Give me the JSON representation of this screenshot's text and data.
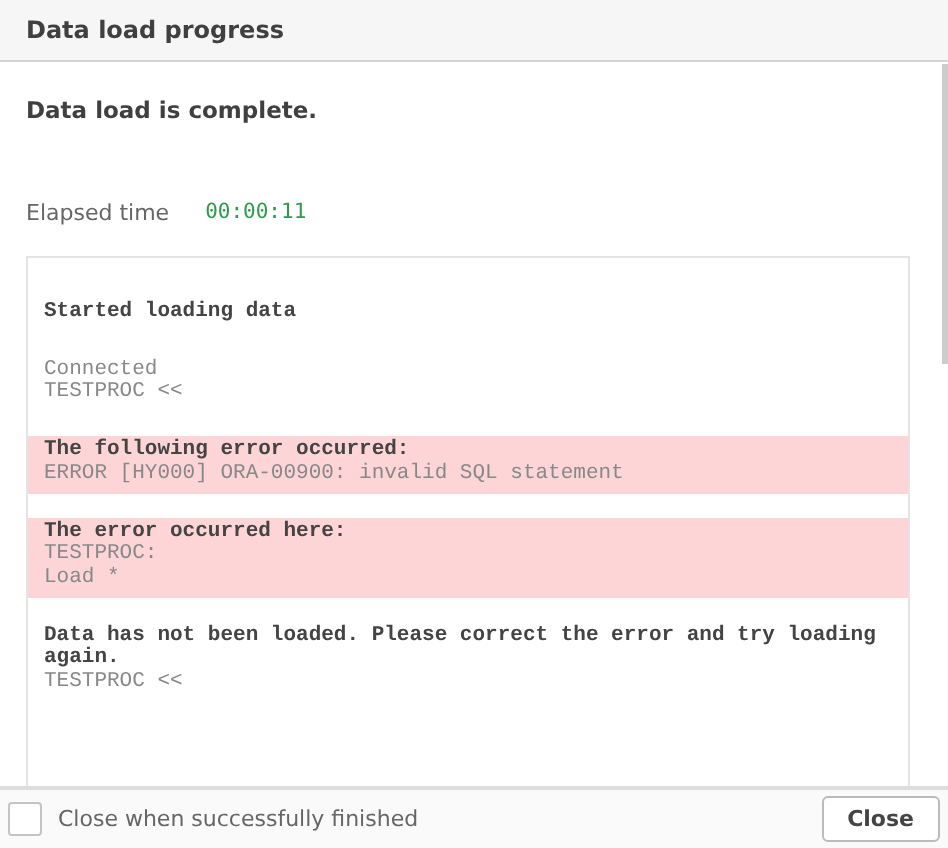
{
  "window": {
    "title": "Data load progress"
  },
  "status": "Data load is complete.",
  "elapsed": {
    "label": "Elapsed time",
    "value": "00:00:11"
  },
  "log": [
    {
      "kind": "info",
      "lines": [
        {
          "text": "Started loading data",
          "bold": true
        }
      ]
    },
    {
      "kind": "info",
      "lines": [
        {
          "text": "Connected",
          "bold": false
        },
        {
          "text": "TESTPROC <<",
          "bold": false
        }
      ]
    },
    {
      "kind": "error",
      "lines": [
        {
          "text": "The following error occurred:",
          "bold": true
        },
        {
          "text": "ERROR [HY000] ORA-00900: invalid SQL statement",
          "bold": false
        }
      ]
    },
    {
      "kind": "error",
      "lines": [
        {
          "text": "The error occurred here:",
          "bold": true
        },
        {
          "text": "TESTPROC:",
          "bold": false
        },
        {
          "text": "Load *",
          "bold": false
        }
      ]
    },
    {
      "kind": "info",
      "lines": [
        {
          "text": "Data has not been loaded. Please correct the error and try loading again.",
          "bold": true
        },
        {
          "text": "TESTPROC <<",
          "bold": false
        }
      ]
    }
  ],
  "footer": {
    "checkbox": {
      "label": "Close when successfully finished",
      "checked": false
    },
    "button": "Close"
  }
}
